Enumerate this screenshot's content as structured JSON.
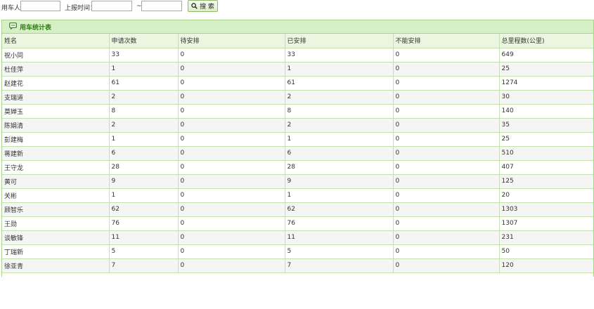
{
  "search": {
    "user_label": "用车人",
    "user_value": "",
    "date_label": "上报时间：",
    "date_from_value": "",
    "date_sep": "~",
    "date_to_value": "",
    "button_label": "搜 索",
    "button_icon": "search-icon"
  },
  "panel": {
    "title": "用车统计表",
    "title_icon": "chat-bubble-icon",
    "accent_color": "#2f7d15",
    "header_bg": "#d7efc4"
  },
  "table": {
    "columns": [
      "姓名",
      "申请次数",
      "待安排",
      "已安排",
      "不能安排",
      "总里程数(公里)"
    ],
    "rows": [
      [
        "祝小同",
        "33",
        "0",
        "33",
        "0",
        "649"
      ],
      [
        "杜佳萍",
        "1",
        "0",
        "1",
        "0",
        "25"
      ],
      [
        "赵建花",
        "61",
        "0",
        "61",
        "0",
        "1274"
      ],
      [
        "支瑞道",
        "2",
        "0",
        "2",
        "0",
        "30"
      ],
      [
        "莫婵玉",
        "8",
        "0",
        "8",
        "0",
        "140"
      ],
      [
        "陈娟清",
        "2",
        "0",
        "2",
        "0",
        "35"
      ],
      [
        "彭建梅",
        "1",
        "0",
        "1",
        "0",
        "25"
      ],
      [
        "蒋建新",
        "6",
        "0",
        "6",
        "0",
        "510"
      ],
      [
        "王守龙",
        "28",
        "0",
        "28",
        "0",
        "407"
      ],
      [
        "黄可",
        "9",
        "0",
        "9",
        "0",
        "125"
      ],
      [
        "关彬",
        "1",
        "0",
        "1",
        "0",
        "20"
      ],
      [
        "顾智乐",
        "62",
        "0",
        "62",
        "0",
        "1303"
      ],
      [
        "王勋",
        "76",
        "0",
        "76",
        "0",
        "1307"
      ],
      [
        "谈敏锋",
        "11",
        "0",
        "11",
        "0",
        "231"
      ],
      [
        "丁瑞新",
        "5",
        "0",
        "5",
        "0",
        "50"
      ],
      [
        "徐亚青",
        "7",
        "0",
        "7",
        "0",
        "120"
      ]
    ]
  }
}
